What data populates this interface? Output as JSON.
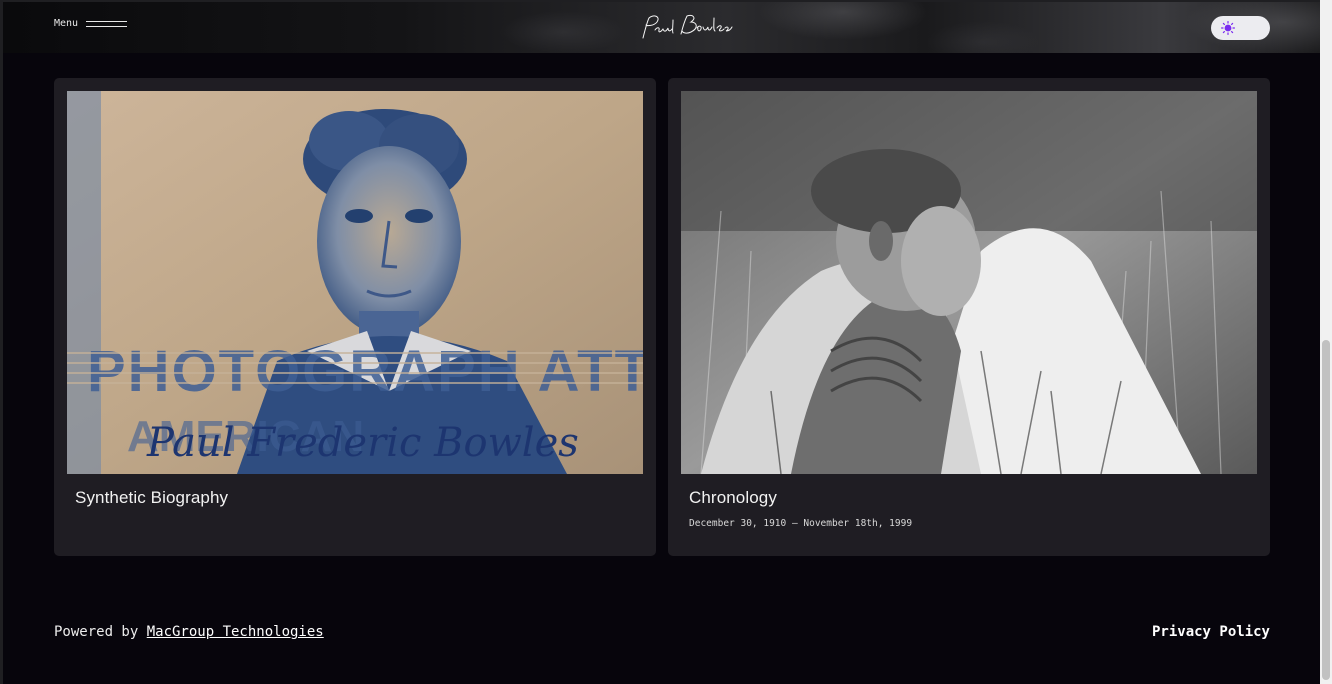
{
  "header": {
    "menu_label": "Menu",
    "logo_text": "Paul Bowles",
    "toggle_accent": "#7b2cf0"
  },
  "cards": [
    {
      "title": "Synthetic Biography",
      "subtitle": "",
      "image": "passport-photo-icon",
      "image_text": "PHOTOGRAPH ATTACH",
      "image_signature": "Paul Frederic Bowles"
    },
    {
      "title": "Chronology",
      "subtitle": "December 30, 1910 — November 18th, 1999",
      "image": "grass-portrait-photo-icon"
    }
  ],
  "footer": {
    "powered_prefix": "Powered by ",
    "powered_link": "MacGroup Technologies",
    "privacy": "Privacy Policy"
  },
  "colors": {
    "background": "#07050c",
    "card": "#1f1d23",
    "text": "#ffffff"
  }
}
